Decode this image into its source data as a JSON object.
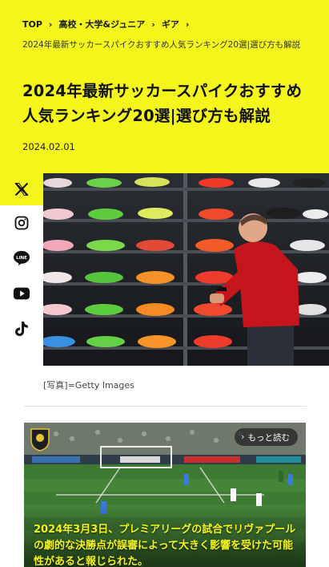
{
  "breadcrumb": {
    "items": [
      "TOP",
      "高校・大学&ジュニア",
      "ギア"
    ],
    "separator": "›",
    "current": "2024年最新サッカースパイクおすすめ人気ランキング20選|選び方も解説"
  },
  "article": {
    "title": "2024年最新サッカースパイクおすすめ人気ランキング20選|選び方も解説",
    "date": "2024.02.01"
  },
  "share": {
    "items": [
      {
        "icon": "x-icon"
      },
      {
        "icon": "instagram-icon"
      },
      {
        "icon": "line-icon",
        "label": "LINE"
      },
      {
        "icon": "youtube-icon"
      },
      {
        "icon": "tiktok-icon"
      }
    ]
  },
  "photo": {
    "caption": "[写真]=Getty Images"
  },
  "related": {
    "more_label": "もっと読む",
    "text": "2024年3月3日、プレミアリーグの試合でリヴァプールの劇的な決勝点が誤審によって大きく影響を受けた可能性があると報じられた。"
  },
  "colors": {
    "accent": "#f4f51b",
    "text": "#111111"
  }
}
